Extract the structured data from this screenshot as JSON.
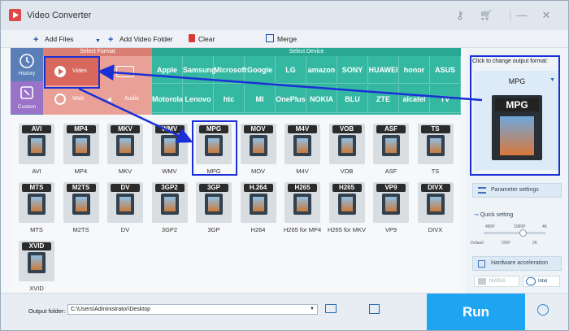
{
  "app": {
    "title": "Video Converter"
  },
  "toolbar": {
    "add_files": "Add Files",
    "add_folder": "Add Video Folder",
    "clear": "Clear",
    "merge": "Merge"
  },
  "format_header": {
    "select_format": "Select Format",
    "select_device": "Select Device"
  },
  "sidebar": [
    {
      "label": "History",
      "icon": "history-icon"
    },
    {
      "label": "Custom",
      "icon": "custom-icon"
    }
  ],
  "categories": [
    {
      "label": "Video",
      "icon": "video-play-icon"
    },
    {
      "label": "Web",
      "icon": "globe-icon"
    },
    {
      "label": "Audio",
      "icon": "speaker-icon"
    }
  ],
  "brands_row1": [
    "Apple",
    "Samsung",
    "Microsoft",
    "Google",
    "LG",
    "amazon",
    "SONY",
    "HUAWEI",
    "honor",
    "ASUS"
  ],
  "brands_row2": [
    "Motorola",
    "Lenovo",
    "htc",
    "MI",
    "OnePlus",
    "NOKIA",
    "BLU",
    "ZTE",
    "alcatel",
    "TV"
  ],
  "formats": [
    {
      "badge": "AVI",
      "label": "AVI"
    },
    {
      "badge": "MP4",
      "label": "MP4"
    },
    {
      "badge": "MKV",
      "label": "MKV"
    },
    {
      "badge": "WMV",
      "label": "WMV"
    },
    {
      "badge": "MPG",
      "label": "MPG"
    },
    {
      "badge": "MOV",
      "label": "MOV"
    },
    {
      "badge": "M4V",
      "label": "M4V"
    },
    {
      "badge": "VOB",
      "label": "VOB"
    },
    {
      "badge": "ASF",
      "label": "ASF"
    },
    {
      "badge": "TS",
      "label": "TS"
    },
    {
      "badge": "MTS",
      "label": "MTS"
    },
    {
      "badge": "M2TS",
      "label": "M2TS"
    },
    {
      "badge": "DV",
      "label": "DV"
    },
    {
      "badge": "3GP2",
      "label": "3GP2"
    },
    {
      "badge": "3GP",
      "label": "3GP"
    },
    {
      "badge": "H.264",
      "label": "H264"
    },
    {
      "badge": "H265",
      "label": "H265 for MP4"
    },
    {
      "badge": "H265",
      "label": "H265 for MKV"
    },
    {
      "badge": "VP9",
      "label": "VP9"
    },
    {
      "badge": "DIVX",
      "label": "DIVX"
    },
    {
      "badge": "XVID",
      "label": "XVID"
    }
  ],
  "right_panel": {
    "hint": "Click to change output format:",
    "selected_format": "MPG",
    "thumb_badge": "MPG",
    "parameter_settings": "Parameter settings",
    "quick_setting": "Quick setting",
    "ticks_top": [
      "480P",
      "1080P",
      "4K"
    ],
    "ticks_bottom": [
      "Default",
      "720P",
      "2K"
    ],
    "hw_accel": "Hardware acceleration",
    "chip_nvidia": "NVIDIA",
    "chip_intel": "Intel"
  },
  "bottom": {
    "output_folder_label": "Output folder:",
    "output_folder_value": "C:\\Users\\Administrator\\Desktop",
    "run": "Run"
  },
  "colors": {
    "accent": "#1fa4f1",
    "annotation": "#1b2fd6",
    "device_panel": "#34b8a2",
    "category_panel": "#e9a096",
    "sidebar": "#5a7fb8"
  }
}
